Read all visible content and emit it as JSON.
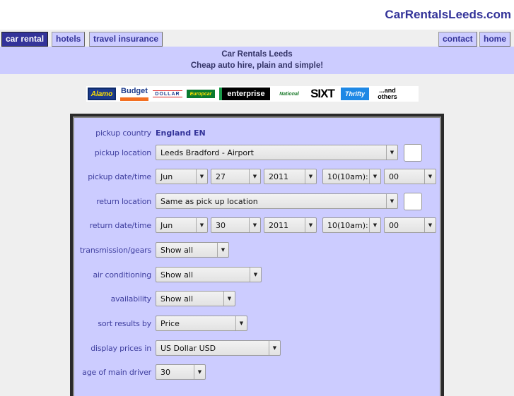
{
  "site": {
    "title": "CarRentalsLeeds.com"
  },
  "nav": {
    "left": [
      {
        "label": "car rental",
        "active": true
      },
      {
        "label": "hotels",
        "active": false
      },
      {
        "label": "travel insurance",
        "active": false
      }
    ],
    "right": [
      {
        "label": "contact"
      },
      {
        "label": "home"
      }
    ]
  },
  "banner": {
    "title": "Car Rentals Leeds",
    "subtitle": "Cheap auto hire, plain and simple!"
  },
  "logos": {
    "alamo": "Alamo",
    "budget": "Budget",
    "dollar": "DOLLAR",
    "europcar": "Europcar",
    "enterprise": "enterprise",
    "national": "National",
    "sixt": "SIXT",
    "thrifty": "Thrifty",
    "others_line1": "...and",
    "others_line2": "others"
  },
  "form": {
    "pickup_country": {
      "label": "pickup country",
      "value": "England EN"
    },
    "pickup_location": {
      "label": "pickup location",
      "value": "Leeds Bradford - Airport"
    },
    "pickup_datetime": {
      "label": "pickup date/time",
      "month": "Jun",
      "day": "27",
      "year": "2011",
      "hour": "10(10am):",
      "minute": "00"
    },
    "return_location": {
      "label": "return location",
      "value": "Same as pick up location"
    },
    "return_datetime": {
      "label": "return date/time",
      "month": "Jun",
      "day": "30",
      "year": "2011",
      "hour": "10(10am):",
      "minute": "00"
    },
    "transmission": {
      "label": "transmission/gears",
      "value": "Show all"
    },
    "air_conditioning": {
      "label": "air conditioning",
      "value": "Show all"
    },
    "availability": {
      "label": "availability",
      "value": "Show all"
    },
    "sort_by": {
      "label": "sort results by",
      "value": "Price"
    },
    "currency": {
      "label": "display prices in",
      "value": "US Dollar USD"
    },
    "driver_age": {
      "label": "age of main driver",
      "value": "30"
    }
  }
}
